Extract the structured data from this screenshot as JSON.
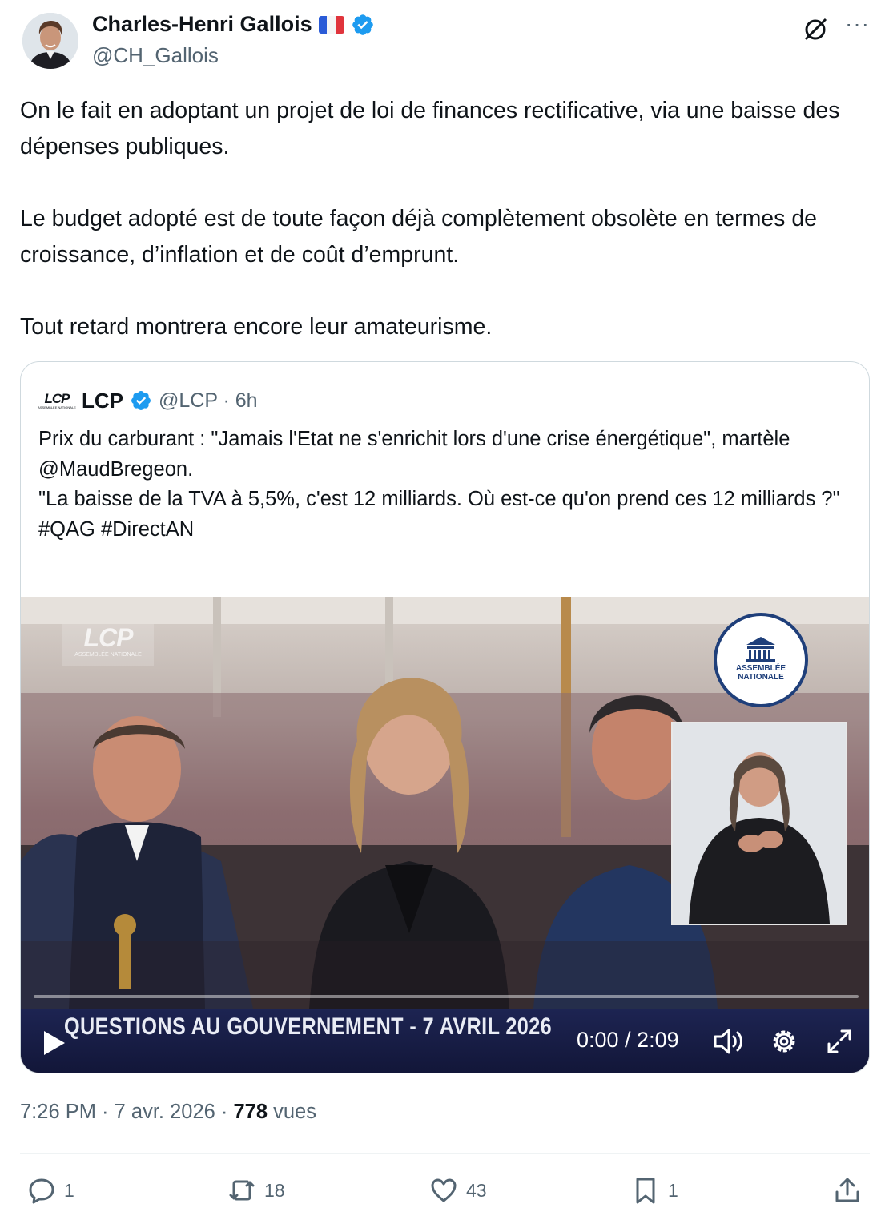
{
  "author": {
    "name": "Charles-Henri Gallois",
    "handle": "@CH_Gallois",
    "flag_icon": "france-flag-icon",
    "verified_icon": "verified-badge-icon"
  },
  "header_actions": {
    "grok_icon": "grok-icon",
    "more_icon": "more-icon"
  },
  "tweet": {
    "paragraphs": [
      "On le fait en adoptant un projet de loi de finances rectificative, via une baisse des dépenses publiques.",
      "Le budget adopté est de toute façon déjà complètement obsolète en termes de croissance, d’inflation et de coût d’emprunt.",
      "Tout retard montrera encore leur amateurisme."
    ]
  },
  "quote": {
    "name": "LCP",
    "handle": "@LCP · 6h",
    "logo_text": "LCP",
    "logo_subtext": "ASSEMBLÉE NATIONALE",
    "text": "Prix du carburant : \"Jamais l'Etat ne s'enrichit lors d'une crise énergétique\", martèle @MaudBregeon.\n\"La baisse de la TVA à 5,5%, c'est 12 milliards. Où est-ce qu'on prend ces 12 milliards ?\"\n#QAG #DirectAN"
  },
  "video": {
    "watermark": "LCP",
    "watermark_sub": "ASSEMBLÉE NATIONALE",
    "assemblee_logo_text": "ASSEMBLÉE NATIONALE",
    "banner": "QUESTIONS AU GOUVERNEMENT - 7 AVRIL 2026",
    "time": "0:00 / 2:09",
    "progress": 0,
    "controls": [
      "play-icon",
      "volume-icon",
      "settings-icon",
      "fullscreen-icon"
    ]
  },
  "meta": {
    "time_date": "7:26 PM · 7 avr. 2026 · ",
    "views_count": "778",
    "views_label": " vues"
  },
  "actions": {
    "replies": "1",
    "reposts": "18",
    "likes": "43",
    "bookmarks": "1"
  },
  "colors": {
    "text": "#0f1419",
    "secondary": "#536471",
    "verified": "#1d9bf0",
    "border": "#cfd9de",
    "video_band": "#1d2452"
  }
}
